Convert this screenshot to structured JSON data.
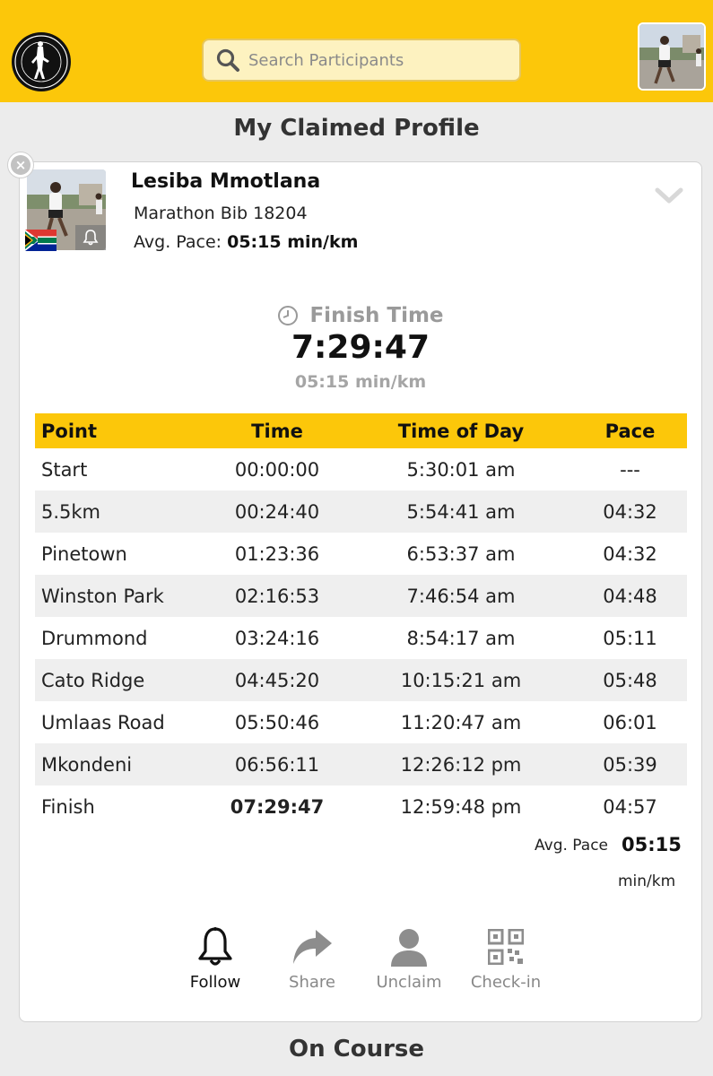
{
  "header": {
    "search_placeholder": "Search Participants",
    "logo_icon": "club-logo-icon",
    "accent_color": "#fcc70a"
  },
  "section_title": "My Claimed Profile",
  "profile": {
    "name": "Lesiba Mmotlana",
    "bib": "Marathon Bib 18204",
    "avg_pace_label": "Avg. Pace:",
    "avg_pace_value": "05:15 min/km",
    "finish_label": "Finish Time",
    "finish_time": "7:29:47",
    "finish_pace": "05:15 min/km"
  },
  "splits": {
    "headers": [
      "Point",
      "Time",
      "Time of Day",
      "Pace"
    ],
    "rows": [
      {
        "point": "Start",
        "time": "00:00:00",
        "tod": "5:30:01 am",
        "pace": "---"
      },
      {
        "point": "5.5km",
        "time": "00:24:40",
        "tod": "5:54:41 am",
        "pace": "04:32"
      },
      {
        "point": "Pinetown",
        "time": "01:23:36",
        "tod": "6:53:37 am",
        "pace": "04:32"
      },
      {
        "point": "Winston Park",
        "time": "02:16:53",
        "tod": "7:46:54 am",
        "pace": "04:48"
      },
      {
        "point": "Drummond",
        "time": "03:24:16",
        "tod": "8:54:17 am",
        "pace": "05:11"
      },
      {
        "point": "Cato Ridge",
        "time": "04:45:20",
        "tod": "10:15:21 am",
        "pace": "05:48"
      },
      {
        "point": "Umlaas Road",
        "time": "05:50:46",
        "tod": "11:20:47 am",
        "pace": "06:01"
      },
      {
        "point": "Mkondeni",
        "time": "06:56:11",
        "tod": "12:26:12 pm",
        "pace": "05:39"
      },
      {
        "point": "Finish",
        "time": "07:29:47",
        "tod": "12:59:48 pm",
        "pace": "04:57"
      }
    ],
    "avg_label": "Avg. Pace",
    "avg_value": "05:15",
    "avg_unit": "min/km"
  },
  "actions": {
    "follow": "Follow",
    "share": "Share",
    "unclaim": "Unclaim",
    "checkin": "Check-in"
  },
  "next_section_title": "On Course"
}
